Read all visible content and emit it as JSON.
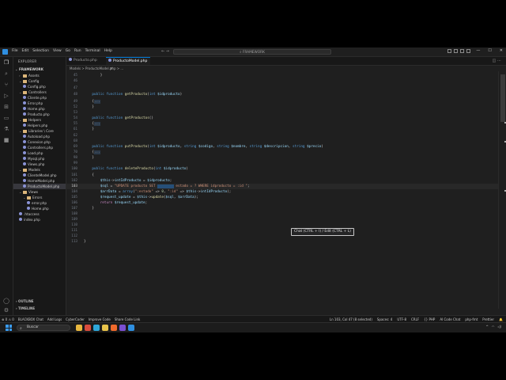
{
  "titlebar": {
    "menu": [
      "File",
      "Edit",
      "Selection",
      "View",
      "Go",
      "Run",
      "Terminal",
      "Help"
    ],
    "search": "FRAMEWORK"
  },
  "sidebar": {
    "title": "EXPLORER",
    "root": "FRAMEWORK",
    "items": [
      {
        "label": "Assets",
        "type": "folder",
        "indent": 1,
        "open": false
      },
      {
        "label": "Config",
        "type": "folder",
        "indent": 1,
        "open": true
      },
      {
        "label": "Config.php",
        "type": "file",
        "indent": 2
      },
      {
        "label": "Controllers",
        "type": "folder",
        "indent": 1,
        "open": true
      },
      {
        "label": "Cliente.php",
        "type": "file",
        "indent": 2
      },
      {
        "label": "Error.php",
        "type": "file",
        "indent": 2
      },
      {
        "label": "Home.php",
        "type": "file",
        "indent": 2
      },
      {
        "label": "Producto.php",
        "type": "file",
        "indent": 2
      },
      {
        "label": "Helpers",
        "type": "folder",
        "indent": 1,
        "open": true
      },
      {
        "label": "Helpers.php",
        "type": "file",
        "indent": 2
      },
      {
        "label": "Libraries \\ Core",
        "type": "folder",
        "indent": 1,
        "open": true
      },
      {
        "label": "Autoload.php",
        "type": "file",
        "indent": 2
      },
      {
        "label": "Conexion.php",
        "type": "file",
        "indent": 2
      },
      {
        "label": "Controllers.php",
        "type": "file",
        "indent": 2
      },
      {
        "label": "Load.php",
        "type": "file",
        "indent": 2
      },
      {
        "label": "Mysql.php",
        "type": "file",
        "indent": 2
      },
      {
        "label": "Views.php",
        "type": "file",
        "indent": 2
      },
      {
        "label": "Models",
        "type": "folder",
        "indent": 1,
        "open": true
      },
      {
        "label": "ClienteModel.php",
        "type": "file",
        "indent": 2
      },
      {
        "label": "HomeModel.php",
        "type": "file",
        "indent": 2
      },
      {
        "label": "ProductoModel.php",
        "type": "file",
        "indent": 2,
        "selected": true
      },
      {
        "label": "Views",
        "type": "folder",
        "indent": 1,
        "open": true
      },
      {
        "label": "Errors",
        "type": "folder",
        "indent": 2,
        "open": true
      },
      {
        "label": "error.php",
        "type": "file",
        "indent": 3
      },
      {
        "label": "Home.php",
        "type": "file",
        "indent": 3
      },
      {
        "label": ".htaccess",
        "type": "file",
        "indent": 1
      },
      {
        "label": "index.php",
        "type": "file",
        "indent": 1
      }
    ],
    "outline": "OUTLINE",
    "timeline": "TIMELINE"
  },
  "tabs": [
    {
      "label": "Producto.php",
      "active": false
    },
    {
      "label": "ProductoModel.php",
      "active": true
    }
  ],
  "breadcrumb": "Models > ProductoModel.php > ...",
  "editor": {
    "current_line": "103",
    "lines": [
      {
        "n": "45",
        "tokens": [
          [
            "code",
            "        }"
          ]
        ]
      },
      {
        "n": "46",
        "tokens": []
      },
      {
        "n": "47",
        "tokens": []
      },
      {
        "n": "48",
        "tokens": [
          [
            "kw",
            "    public function "
          ],
          [
            "fn",
            "getProducto"
          ],
          [
            "code",
            "("
          ],
          [
            "kw",
            "int "
          ],
          [
            "var",
            "$idproducto"
          ],
          [
            "code",
            ")"
          ]
        ]
      },
      {
        "n": "49",
        "tokens": [
          [
            "code",
            "    {"
          ],
          [
            "folded",
            "..."
          ]
        ]
      },
      {
        "n": "52",
        "tokens": [
          [
            "code",
            "    }"
          ]
        ]
      },
      {
        "n": "53",
        "tokens": []
      },
      {
        "n": "54",
        "tokens": [
          [
            "kw",
            "    public function "
          ],
          [
            "fn",
            "getProductos"
          ],
          [
            "code",
            "()"
          ]
        ]
      },
      {
        "n": "55",
        "tokens": [
          [
            "code",
            "    {"
          ],
          [
            "folded",
            "..."
          ]
        ]
      },
      {
        "n": "61",
        "tokens": [
          [
            "code",
            "    }"
          ]
        ]
      },
      {
        "n": "62",
        "tokens": []
      },
      {
        "n": "68",
        "tokens": []
      },
      {
        "n": "69",
        "tokens": [
          [
            "kw",
            "    public function "
          ],
          [
            "fn",
            "putProducto"
          ],
          [
            "code",
            "("
          ],
          [
            "kw",
            "int "
          ],
          [
            "var",
            "$idproducto"
          ],
          [
            "code",
            ", "
          ],
          [
            "kw",
            "string "
          ],
          [
            "var",
            "$codigo"
          ],
          [
            "code",
            ", "
          ],
          [
            "kw",
            "string "
          ],
          [
            "var",
            "$nombre"
          ],
          [
            "code",
            ", "
          ],
          [
            "kw",
            "string "
          ],
          [
            "var",
            "$descripcion"
          ],
          [
            "code",
            ", "
          ],
          [
            "kw",
            "string "
          ],
          [
            "var",
            "$precio"
          ],
          [
            "code",
            ")"
          ]
        ]
      },
      {
        "n": "70",
        "tokens": [
          [
            "code",
            "    {"
          ],
          [
            "folded",
            "..."
          ]
        ]
      },
      {
        "n": "98",
        "tokens": [
          [
            "code",
            "    }"
          ]
        ]
      },
      {
        "n": "99",
        "tokens": []
      },
      {
        "n": "100",
        "tokens": [
          [
            "kw",
            "    public function "
          ],
          [
            "fn",
            "deleteProducto"
          ],
          [
            "code",
            "("
          ],
          [
            "kw",
            "int "
          ],
          [
            "var",
            "$idproducto"
          ],
          [
            "code",
            ")"
          ]
        ]
      },
      {
        "n": "101",
        "tokens": [
          [
            "code",
            "    {"
          ]
        ]
      },
      {
        "n": "102",
        "tokens": [
          [
            "var",
            "        $this"
          ],
          [
            "code",
            "->"
          ],
          [
            "var",
            "intIdProducto"
          ],
          [
            "code",
            " = "
          ],
          [
            "var",
            "$idproducto"
          ],
          [
            "code",
            ";"
          ]
        ]
      },
      {
        "n": "103",
        "tokens": [
          [
            "var",
            "        $sql"
          ],
          [
            "code",
            " = "
          ],
          [
            "str",
            "\"UPDATE producto SET "
          ],
          [
            "sel",
            "        "
          ],
          [
            "str",
            " estado = ? WHERE idproducto = :id \""
          ],
          [
            "code",
            ";"
          ]
        ]
      },
      {
        "n": "104",
        "tokens": [
          [
            "var",
            "        $arrData"
          ],
          [
            "code",
            " = "
          ],
          [
            "kw",
            "array"
          ],
          [
            "code",
            "("
          ],
          [
            "str",
            "\":estado\""
          ],
          [
            "code",
            " => "
          ],
          [
            "num",
            "0"
          ],
          [
            "code",
            ", "
          ],
          [
            "str",
            "\":id\""
          ],
          [
            "code",
            " => "
          ],
          [
            "var",
            "$this"
          ],
          [
            "code",
            "->"
          ],
          [
            "var",
            "intIdProducto"
          ],
          [
            "code",
            ");"
          ]
        ]
      },
      {
        "n": "105",
        "tokens": [
          [
            "var",
            "        $request_update"
          ],
          [
            "code",
            " = "
          ],
          [
            "var",
            "$this"
          ],
          [
            "code",
            "->"
          ],
          [
            "fn",
            "update"
          ],
          [
            "code",
            "("
          ],
          [
            "var",
            "$sql"
          ],
          [
            "code",
            ", "
          ],
          [
            "var",
            "$arrData"
          ],
          [
            "code",
            ");"
          ]
        ]
      },
      {
        "n": "106",
        "tokens": [
          [
            "sqlk",
            "        return "
          ],
          [
            "var",
            "$request_update"
          ],
          [
            "code",
            ";"
          ]
        ]
      },
      {
        "n": "107",
        "tokens": [
          [
            "code",
            "    }"
          ]
        ]
      },
      {
        "n": "108",
        "tokens": []
      },
      {
        "n": "109",
        "tokens": []
      },
      {
        "n": "110",
        "tokens": []
      },
      {
        "n": "111",
        "tokens": []
      },
      {
        "n": "112",
        "tokens": []
      },
      {
        "n": "113",
        "tokens": [
          [
            "code",
            "}"
          ]
        ]
      }
    ]
  },
  "tooltip": "Chat (CTRL + I) / Edit (CTRL + L)",
  "statusbar": {
    "left": [
      "⊗ 0 ⚠ 0",
      "BLACKBOX Chat",
      "Add Logs",
      "CyberCoder",
      "Improve Code",
      "Share Code Link"
    ],
    "right": [
      "Ln 103, Col 47 (8 selected)",
      "Spaces: 4",
      "UTF-8",
      "CRLF",
      "{} PHP",
      "AI Code Chat",
      "php-fmt",
      "Prettier"
    ]
  },
  "taskbar": {
    "search": "Buscar",
    "apps": [
      {
        "name": "file-explorer-icon",
        "color": "#e8b73f"
      },
      {
        "name": "chrome-icon",
        "color": "#d94c3d"
      },
      {
        "name": "edge-icon",
        "color": "#2ea7d9"
      },
      {
        "name": "folder-icon",
        "color": "#e8c34a"
      },
      {
        "name": "firefox-icon",
        "color": "#ef6a2c"
      },
      {
        "name": "app-icon",
        "color": "#7a4fd1"
      },
      {
        "name": "vscode-icon",
        "color": "#2f8fe0"
      }
    ]
  }
}
